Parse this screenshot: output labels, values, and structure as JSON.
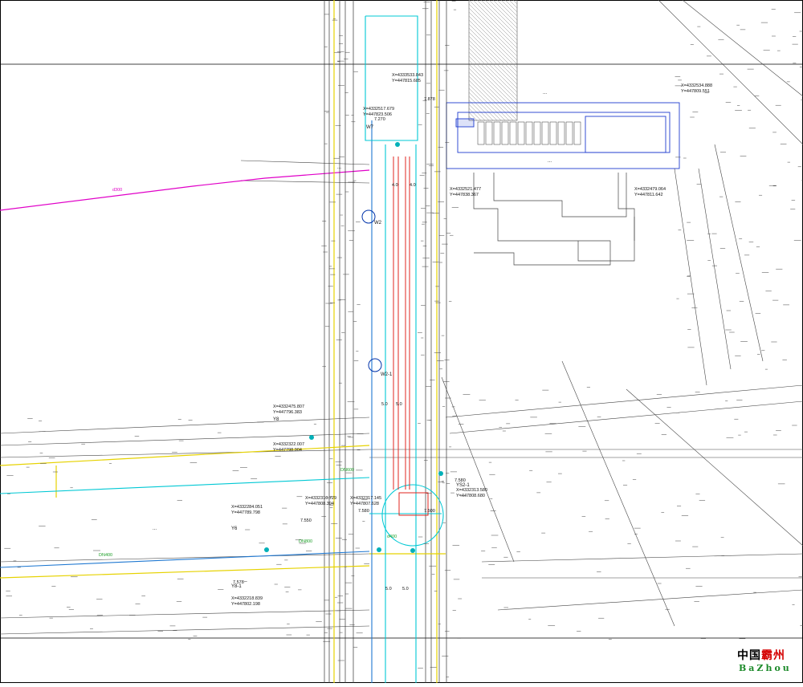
{
  "drawing": {
    "title_plate": "...",
    "road_name_left": "...",
    "station_labels": [
      "...",
      "..."
    ],
    "coordinates": [
      {
        "x": "X=4333533.843",
        "y": "Y=447815.685"
      },
      {
        "x": "X=4332517.679",
        "y": "Y=447823.506"
      },
      {
        "x": "X=4332534.888",
        "y": "Y=447809.551"
      },
      {
        "x": "X=4332521.477",
        "y": "Y=447838.367"
      },
      {
        "x": "X=4332479.064",
        "y": "Y=447811.642"
      },
      {
        "x": "X=4332475.807",
        "y": "Y=447796.383"
      },
      {
        "x": "X=4332322.007",
        "y": "Y=447798.904"
      },
      {
        "x": "X=4332310.729",
        "y": "Y=447808.394"
      },
      {
        "x": "X=4332317.145",
        "y": "Y=447807.628"
      },
      {
        "x": "X=4332313.580",
        "y": "Y=447808.680"
      },
      {
        "x": "X=4332284.051",
        "y": "Y=447789.798"
      },
      {
        "x": "X=4332218.839",
        "y": "Y=447802.198"
      }
    ],
    "elevations": [
      "7.270",
      "7.878",
      "7.580",
      "7.578",
      "7.580",
      "7.550",
      "7.500",
      "5.0",
      "5.0",
      "5.0",
      "5.0",
      "4.0",
      "4.0"
    ],
    "manhole_ids": [
      "W2",
      "W2-1",
      "Y8",
      "Y8-1",
      "YS2-1",
      "W7",
      "Y6"
    ],
    "pipe_labels": [
      "d300",
      "d400",
      "DN600",
      "DN400",
      "DN800"
    ]
  },
  "watermark": {
    "line1_black": "中国",
    "line1_red": "霸州",
    "line2": "BaZhou"
  },
  "colors": {
    "background": "#ffffff",
    "linework": "#333333",
    "grid": "#000000",
    "yellow_pipe": "#e6d200",
    "blue_pipe": "#1f78d1",
    "cyan_pipe": "#00c8d4",
    "red_pipe": "#e0261f",
    "magenta_pipe": "#e000c8",
    "green_text": "#1fa02a",
    "blue_building": "#1e3ccf"
  }
}
